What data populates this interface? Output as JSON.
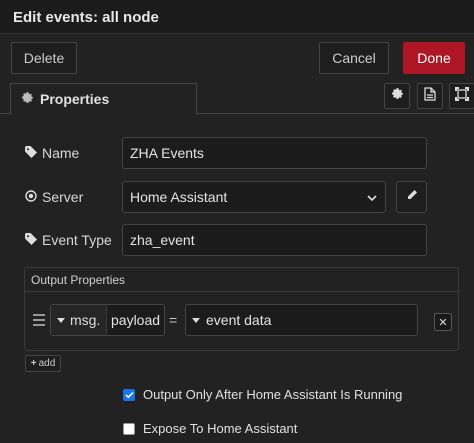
{
  "window": {
    "title": "Edit events: all node"
  },
  "toolbar": {
    "delete_label": "Delete",
    "cancel_label": "Cancel",
    "done_label": "Done"
  },
  "tabs": {
    "properties_label": "Properties"
  },
  "form": {
    "name_label": "Name",
    "name_value": "ZHA Events",
    "server_label": "Server",
    "server_value": "Home Assistant",
    "event_type_label": "Event Type",
    "event_type_value": "zha_event"
  },
  "output_properties": {
    "header": "Output Properties",
    "rows": [
      {
        "target_prefix": "msg.",
        "target_value": "payload",
        "operator": "=",
        "source_value": "event data"
      }
    ],
    "add_label": "add"
  },
  "checkboxes": {
    "output_only_label": "Output Only After Home Assistant Is Running",
    "output_only_checked": true,
    "expose_label": "Expose To Home Assistant",
    "expose_checked": false
  },
  "colors": {
    "done_bg": "#ad1625",
    "checkbox_on": "#1a73e8",
    "background": "#222222"
  }
}
